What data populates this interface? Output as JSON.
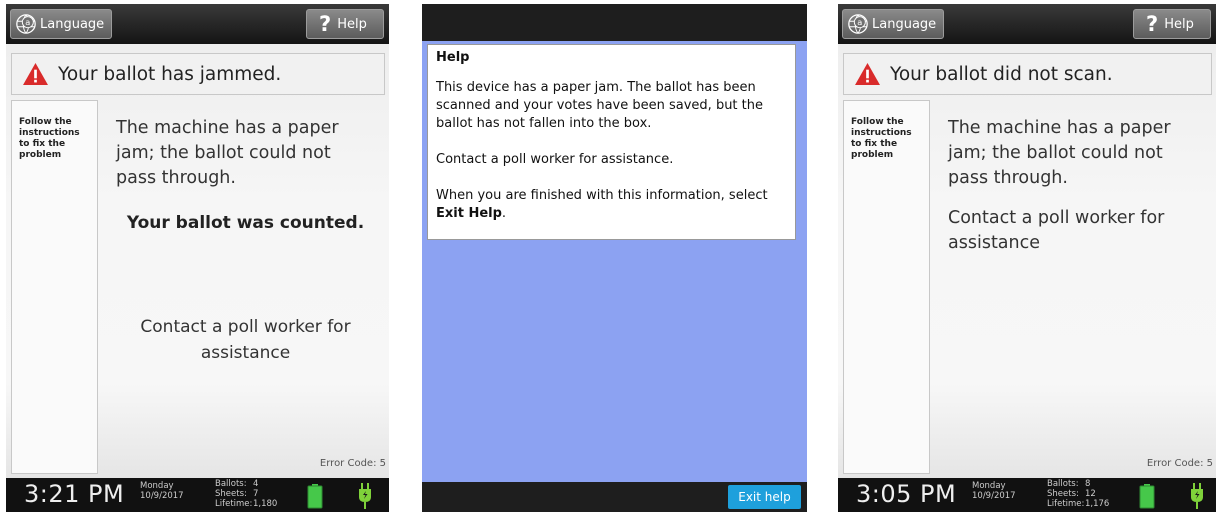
{
  "screens": [
    {
      "language_label": "Language",
      "help_label": "Help",
      "alert": "Your ballot has jammed.",
      "side_text": "Follow the instructions to fix the problem",
      "message": "The machine has a paper jam; the ballot could not pass through.",
      "counted": "Your ballot was counted.",
      "contact": "Contact a poll worker for assistance",
      "error_code": "Error Code: 5",
      "time": "3:21 PM",
      "day": "Monday",
      "date": "10/9/2017",
      "ballots_label": "Ballots:",
      "ballots": "4",
      "sheets_label": "Sheets:",
      "sheets": "7",
      "lifetime_label": "Lifetime:",
      "lifetime": "1,180"
    },
    {
      "title": "Help",
      "p1": "This device has a paper jam. The ballot has been scanned and your votes have been saved, but the ballot has not fallen into the box.",
      "p2": "Contact a poll worker for assistance.",
      "p3_prefix": "When you are finished with this information, select ",
      "p3_bold": "Exit Help",
      "p3_suffix": ".",
      "exit_button": "Exit help"
    },
    {
      "language_label": "Language",
      "help_label": "Help",
      "alert": "Your ballot did not scan.",
      "side_text": "Follow the instructions to fix the problem",
      "message": "The machine has a paper jam; the ballot could not pass through.",
      "contact": "Contact a poll worker for assistance",
      "error_code": "Error Code: 5",
      "time": "3:05 PM",
      "day": "Monday",
      "date": "10/9/2017",
      "ballots_label": "Ballots:",
      "ballots": "8",
      "sheets_label": "Sheets:",
      "sheets": "12",
      "lifetime_label": "Lifetime:",
      "lifetime": "1,176"
    }
  ],
  "colors": {
    "alert_icon": "#d92b2b",
    "battery": "#46c84a",
    "plug": "#7fd23a",
    "help_background": "#8ca2f2",
    "exit_button": "#1ea0dc"
  },
  "icons": [
    "language-icon",
    "question-icon",
    "warning-icon",
    "battery-icon",
    "plug-icon"
  ]
}
